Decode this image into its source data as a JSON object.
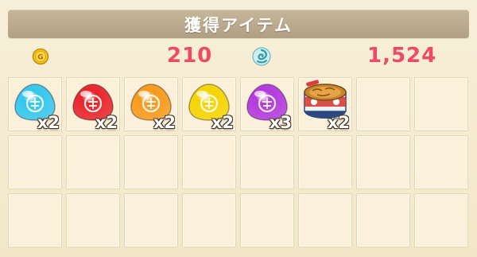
{
  "header": {
    "title": "獲得アイテム"
  },
  "resources": {
    "gold": {
      "icon": "gold-coin-icon",
      "value": "210",
      "color": "#ee4a62"
    },
    "exp": {
      "icon": "swirl-orb-icon",
      "value": "1,524",
      "color": "#ee4a62"
    }
  },
  "items": [
    {
      "icon": "blue-gem-icon",
      "color": "#34c6f0",
      "count": "x2"
    },
    {
      "icon": "red-gem-icon",
      "color": "#e8242c",
      "count": "x2"
    },
    {
      "icon": "orange-gem-icon",
      "color": "#f79a1c",
      "count": "x2"
    },
    {
      "icon": "yellow-gem-icon",
      "color": "#f6d400",
      "count": "x2"
    },
    {
      "icon": "purple-gem-icon",
      "color": "#b338e0",
      "count": "x3"
    },
    {
      "icon": "canned-food-icon",
      "color": "#d9342c",
      "count": "x2"
    }
  ]
}
